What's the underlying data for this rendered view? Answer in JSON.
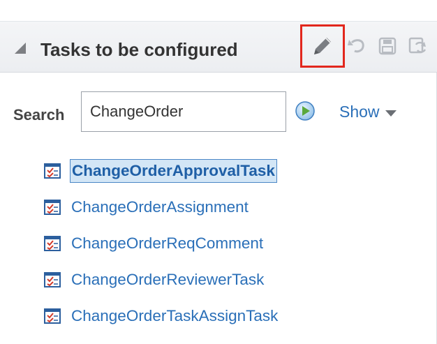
{
  "panel": {
    "title": "Tasks to be configured"
  },
  "toolbar": {
    "icons": [
      "edit-icon",
      "undo-icon",
      "save-icon",
      "refresh-icon"
    ],
    "highlight_color": "#e2271d"
  },
  "search": {
    "label": "Search",
    "value": "ChangeOrder",
    "show_label": "Show"
  },
  "tasks": [
    {
      "label": "ChangeOrderApprovalTask",
      "selected": true
    },
    {
      "label": "ChangeOrderAssignment",
      "selected": false
    },
    {
      "label": "ChangeOrderReqComment",
      "selected": false
    },
    {
      "label": "ChangeOrderReviewerTask",
      "selected": false
    },
    {
      "label": "ChangeOrderTaskAssignTask",
      "selected": false
    }
  ],
  "colors": {
    "link": "#2a6fb8",
    "selection_bg": "#d3e6f6",
    "header_bg": "#eceef1"
  }
}
